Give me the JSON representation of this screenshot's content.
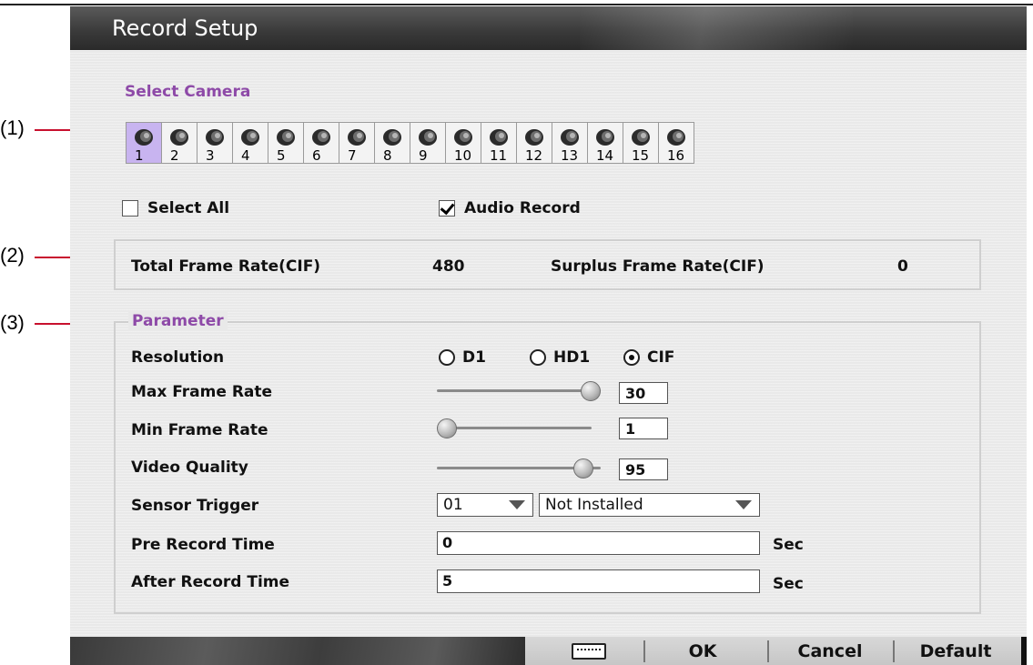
{
  "callouts": [
    "(1)",
    "(2)",
    "(3)"
  ],
  "title": "Record Setup",
  "select_camera": {
    "heading": "Select Camera",
    "selected": "1",
    "cameras": [
      "1",
      "2",
      "3",
      "4",
      "5",
      "6",
      "7",
      "8",
      "9",
      "10",
      "11",
      "12",
      "13",
      "14",
      "15",
      "16"
    ]
  },
  "select_all": {
    "label": "Select All",
    "checked": false
  },
  "audio_record": {
    "label": "Audio Record",
    "checked": true
  },
  "frame_rate": {
    "total_label": "Total Frame Rate(CIF)",
    "total_value": "480",
    "surplus_label": "Surplus Frame Rate(CIF)",
    "surplus_value": "0"
  },
  "parameter": {
    "heading": "Parameter",
    "resolution": {
      "label": "Resolution",
      "options": [
        "D1",
        "HD1",
        "CIF"
      ],
      "selected": "CIF"
    },
    "max_frame_rate": {
      "label": "Max Frame Rate",
      "value": "30",
      "level": 1.0
    },
    "min_frame_rate": {
      "label": "Min Frame Rate",
      "value": "1",
      "level": 0.0
    },
    "video_quality": {
      "label": "Video Quality",
      "value": "95",
      "level": 0.95
    },
    "sensor_trigger": {
      "label": "Sensor Trigger",
      "channel": "01",
      "state": "Not Installed"
    },
    "pre_record_time": {
      "label": "Pre Record Time",
      "value": "0",
      "unit": "Sec"
    },
    "after_record_time": {
      "label": "After Record Time",
      "value": "5",
      "unit": "Sec"
    }
  },
  "buttons": {
    "keyboard_icon": "keyboard-icon",
    "ok": "OK",
    "cancel": "Cancel",
    "default": "Default"
  }
}
